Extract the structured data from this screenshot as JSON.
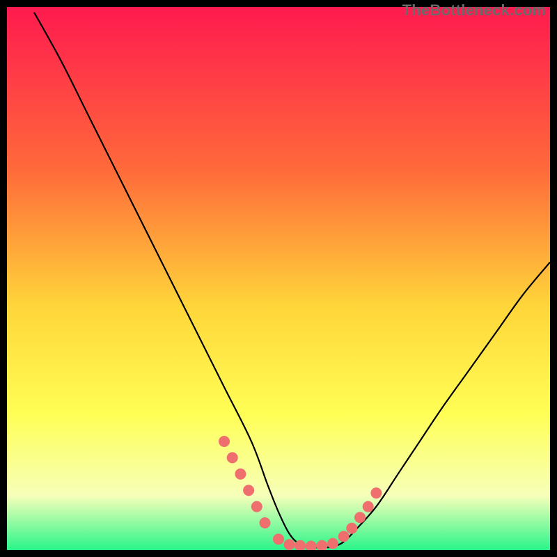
{
  "watermark": "TheBottleneck.com",
  "colors": {
    "grad_top": "#ff1a4f",
    "grad_mid1": "#ff6a3a",
    "grad_mid2": "#ffd53a",
    "grad_mid3": "#ffff55",
    "grad_mid4": "#f6ffb9",
    "grad_bottom": "#29f58a",
    "curve": "#000000",
    "dot": "#ef6f6f",
    "frame": "#000000"
  },
  "chart_data": {
    "type": "line",
    "title": "",
    "xlabel": "",
    "ylabel": "",
    "xlim": [
      0,
      100
    ],
    "ylim": [
      0,
      100
    ],
    "series": [
      {
        "name": "bottleneck-curve",
        "x": [
          5,
          10,
          15,
          20,
          25,
          30,
          35,
          40,
          45,
          48,
          50,
          52,
          54,
          56,
          58,
          60,
          62,
          64,
          68,
          72,
          76,
          80,
          85,
          90,
          95,
          100
        ],
        "values": [
          99,
          90,
          80,
          70,
          60,
          50,
          40,
          30,
          20,
          12,
          7,
          3,
          1,
          0.5,
          0.5,
          0.6,
          1.5,
          3.5,
          8,
          14,
          20,
          26,
          33,
          40,
          47,
          53
        ]
      }
    ],
    "dots": {
      "name": "highlight-dots",
      "x": [
        40,
        41.5,
        43,
        44.5,
        46,
        47.5,
        50,
        52,
        54,
        56,
        58,
        60,
        62,
        63.5,
        65,
        66.5,
        68
      ],
      "values": [
        20,
        17,
        14,
        11,
        8,
        5,
        2,
        1,
        0.8,
        0.7,
        0.8,
        1.2,
        2.5,
        4,
        6,
        8,
        10.5
      ]
    }
  }
}
